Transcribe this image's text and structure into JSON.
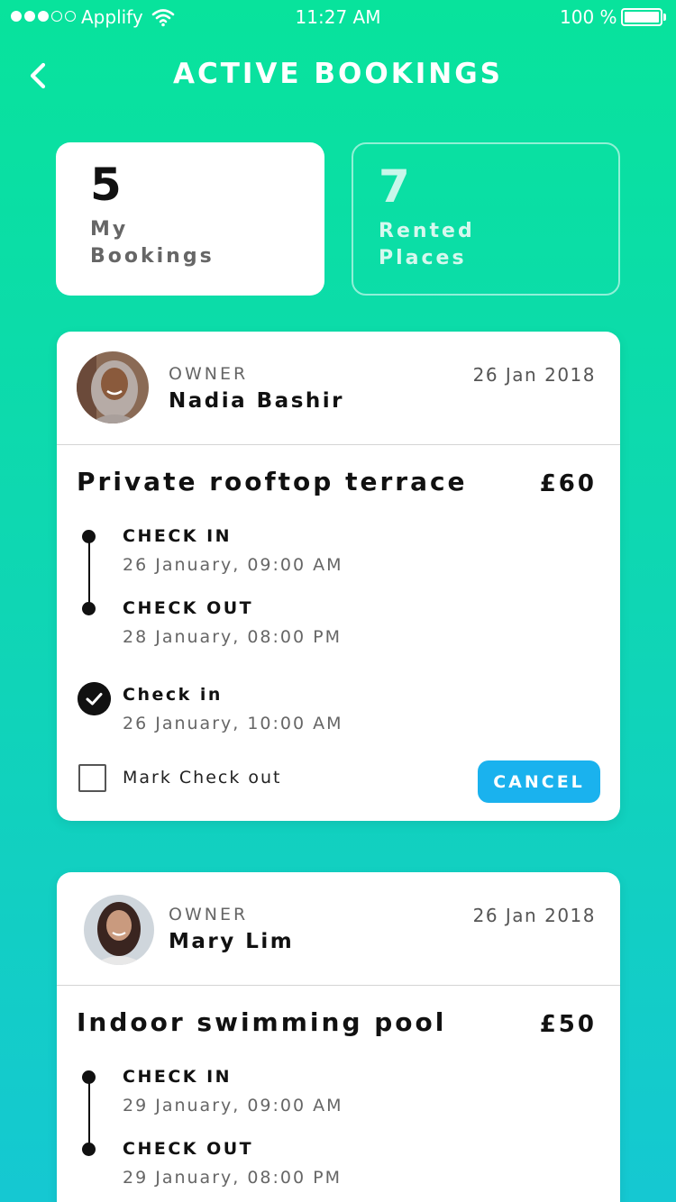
{
  "status_bar": {
    "carrier": "Applify",
    "time": "11:27 AM",
    "battery": "100 %"
  },
  "nav": {
    "title": "ACTIVE BOOKINGS",
    "back_icon": "chevron-left-icon"
  },
  "summary": {
    "my_bookings": {
      "count": "5",
      "label": "My Bookings"
    },
    "rented_places": {
      "count": "7",
      "label": "Rented Places"
    }
  },
  "bookings": [
    {
      "owner_label": "OWNER",
      "owner_name": "Nadia Bashir",
      "date": "26 Jan 2018",
      "place": "Private rooftop terrace",
      "price": "£60",
      "check_in_label": "CHECK IN",
      "check_in_time": "26 January, 09:00 AM",
      "check_out_label": "CHECK OUT",
      "check_out_time": "28 January, 08:00 PM",
      "done_label": "Check in",
      "done_time": "26 January, 10:00 AM",
      "mark_label": "Mark Check out",
      "cancel_label": "CANCEL"
    },
    {
      "owner_label": "OWNER",
      "owner_name": "Mary Lim",
      "date": "26 Jan 2018",
      "place": "Indoor swimming pool",
      "price": "£50",
      "check_in_label": "CHECK IN",
      "check_in_time": "29 January, 09:00 AM",
      "check_out_label": "CHECK OUT",
      "check_out_time": "29 January, 08:00 PM"
    }
  ],
  "colors": {
    "gradient_top": "#08e39c",
    "gradient_bottom": "#15c8d2",
    "accent_button": "#1ab2ee"
  }
}
